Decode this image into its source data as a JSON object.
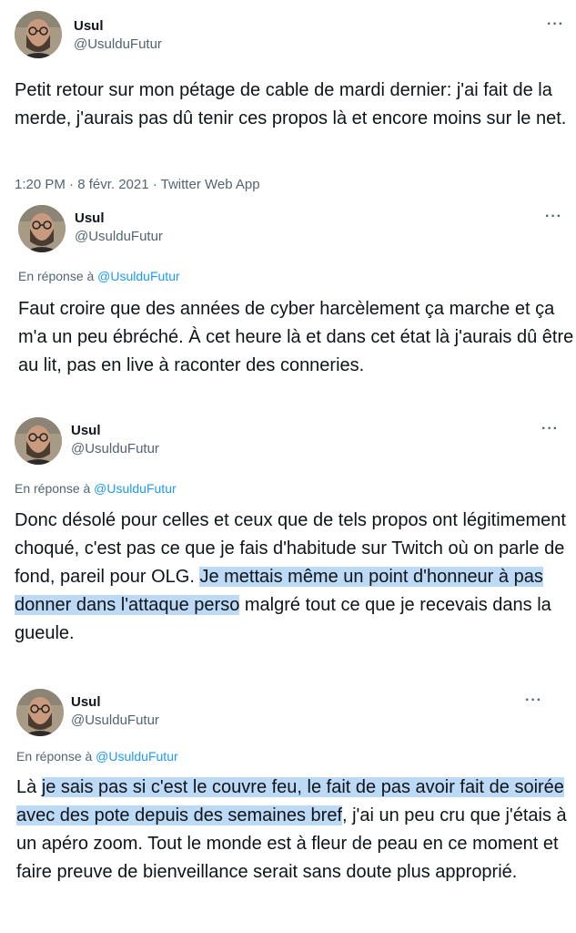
{
  "tweets": [
    {
      "name": "Usul",
      "handle": "@UsulduFutur",
      "more": "···",
      "body_segments": [
        {
          "text": "Petit retour sur mon pétage de cable de mardi dernier: j'ai fait de la merde, j'aurais pas dû tenir ces propos là et encore moins sur le net.",
          "highlight": false
        }
      ],
      "meta": "1:20 PM · 8 févr. 2021 · Twitter Web App"
    },
    {
      "name": "Usul",
      "handle": "@UsulduFutur",
      "more": "···",
      "reply_prefix": "En réponse à ",
      "reply_to": "@UsulduFutur",
      "body_segments": [
        {
          "text": "Faut croire que des années de cyber harcèlement ça marche et ça m'a un peu ébréché. À cet heure là et dans cet état là j'aurais dû être au lit, pas en live à raconter des conneries.",
          "highlight": false
        }
      ]
    },
    {
      "name": "Usul",
      "handle": "@UsulduFutur",
      "more": "···",
      "reply_prefix": "En réponse à ",
      "reply_to": "@UsulduFutur",
      "body_segments": [
        {
          "text": "Donc désolé pour celles et ceux que de tels propos ont légitimement choqué, c'est pas ce que je fais d'habitude sur Twitch où on parle de fond, pareil pour OLG. ",
          "highlight": false
        },
        {
          "text": "Je mettais même un point d'honneur à pas donner dans l'attaque perso",
          "highlight": true
        },
        {
          "text": " malgré tout ce que je recevais dans la gueule.",
          "highlight": false
        }
      ]
    },
    {
      "name": "Usul",
      "handle": "@UsulduFutur",
      "more": "···",
      "reply_prefix": "En réponse à ",
      "reply_to": "@UsulduFutur",
      "body_segments": [
        {
          "text": "Là ",
          "highlight": false
        },
        {
          "text": "je sais pas si c'est le couvre feu, le fait de pas avoir fait de soirée avec des pote depuis des semaines bref",
          "highlight": true
        },
        {
          "text": ", j'ai un peu cru que j'étais à un apéro zoom. Tout le monde est à fleur de peau en ce moment et faire preuve de bienveillance serait sans doute plus approprié.",
          "highlight": false
        }
      ]
    }
  ]
}
